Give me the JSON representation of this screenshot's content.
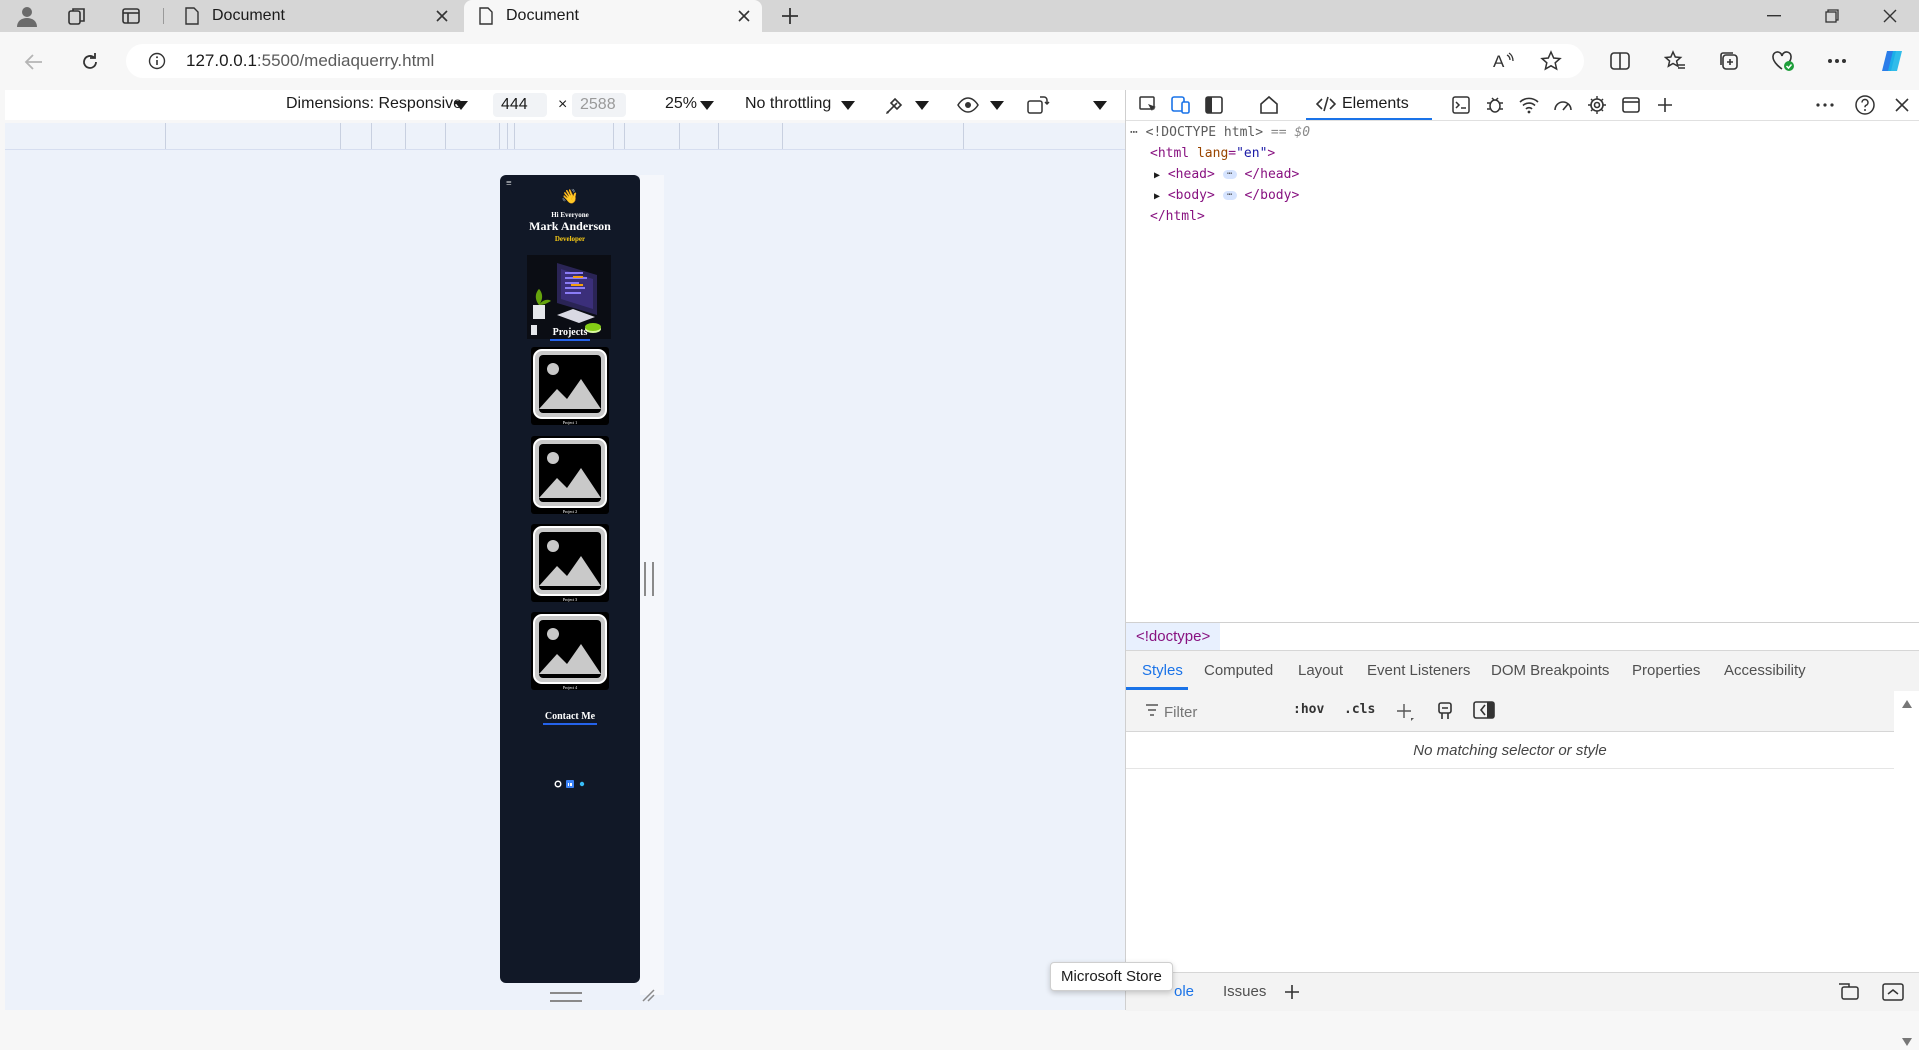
{
  "browser": {
    "tabs": [
      {
        "label": "Document",
        "active": false
      },
      {
        "label": "Document",
        "active": true
      }
    ],
    "address": {
      "host": "127.0.0.1",
      "path": ":5500/mediaquerry.html"
    }
  },
  "device_toolbar": {
    "dimensions_label": "Dimensions: Responsive",
    "width": "444",
    "height_placeholder": "2588",
    "zoom": "25%",
    "throttling": "No throttling"
  },
  "emulated_page": {
    "greeting": "Hi Everyone",
    "name": "Mark Anderson",
    "role": "Developer",
    "projects_title": "Projects",
    "projects": [
      {
        "caption": "Project 1"
      },
      {
        "caption": "Project 2"
      },
      {
        "caption": "Project 3"
      },
      {
        "caption": "Project 4"
      }
    ],
    "contact_title": "Contact Me",
    "colors": {
      "background": "#111827",
      "accent": "#facc15",
      "underline": "#2563eb"
    }
  },
  "devtools": {
    "main_tab": "Elements",
    "dom": {
      "doctype": "<!DOCTYPE html>",
      "doctype_note": "== $0",
      "html_open": "<html",
      "lang_attr": "lang",
      "lang_val": "\"en\"",
      "head_open": "<head>",
      "head_close": "</head>",
      "body_open": "<body>",
      "body_close": "</body>",
      "html_close": "</html>"
    },
    "breadcrumb": "<!doctype>",
    "style_tabs": [
      "Styles",
      "Computed",
      "Layout",
      "Event Listeners",
      "DOM Breakpoints",
      "Properties",
      "Accessibility"
    ],
    "filter_placeholder": "Filter",
    "hov_label": ":hov",
    "cls_label": ".cls",
    "no_match": "No matching selector or style",
    "drawer_tabs": [
      "ole",
      "Issues"
    ]
  },
  "tooltip": "Microsoft Store"
}
